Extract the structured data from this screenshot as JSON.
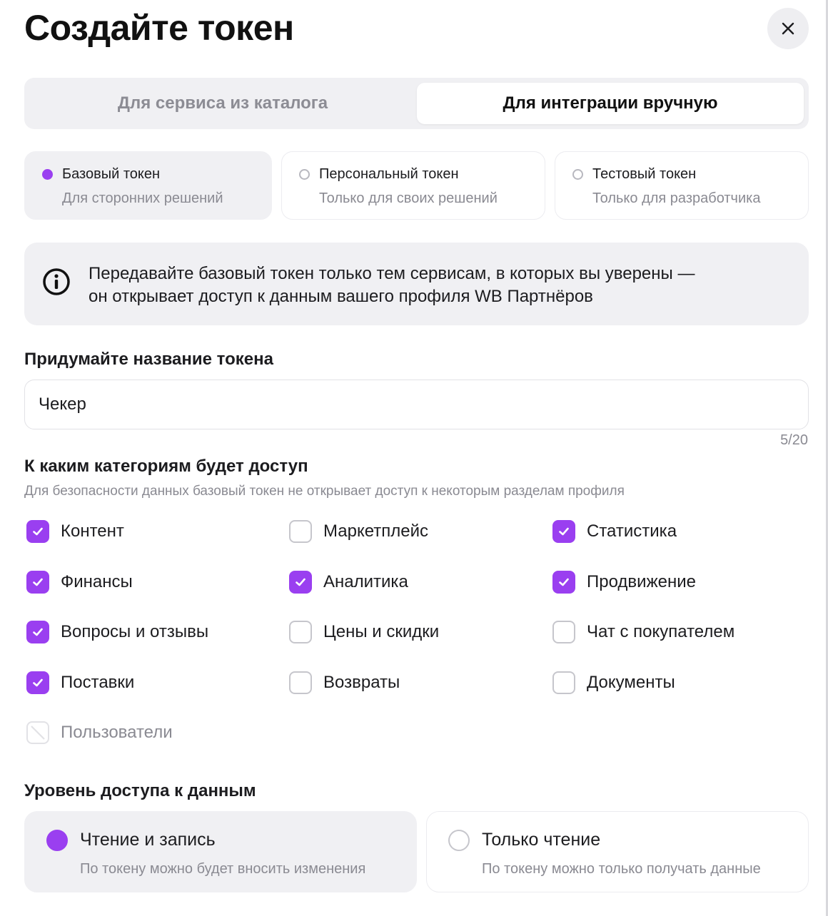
{
  "dialog": {
    "title": "Создайте токен",
    "close_icon": "close-icon"
  },
  "tabs": [
    {
      "label": "Для сервиса из каталога",
      "active": false
    },
    {
      "label": "Для интеграции вручную",
      "active": true
    }
  ],
  "token_types": [
    {
      "title": "Базовый токен",
      "subtitle": "Для сторонних решений",
      "selected": true
    },
    {
      "title": "Персональный токен",
      "subtitle": "Только для своих решений",
      "selected": false
    },
    {
      "title": "Тестовый токен",
      "subtitle": "Только для разработчика",
      "selected": false
    }
  ],
  "notice": {
    "icon": "info-icon",
    "line1": "Передавайте базовый токен только тем сервисам, в которых вы уверены —",
    "line2": "он открывает доступ к данным вашего профиля WB Партнёров"
  },
  "name_field": {
    "label": "Придумайте название токена",
    "value": "Чекер",
    "counter": "5/20"
  },
  "categories": {
    "label": "К каким категориям будет доступ",
    "hint": "Для безопасности данных базовый токен не открывает доступ к некоторым разделам профиля",
    "items": [
      {
        "label": "Контент",
        "checked": true,
        "disabled": false
      },
      {
        "label": "Маркетплейс",
        "checked": false,
        "disabled": false
      },
      {
        "label": "Статистика",
        "checked": true,
        "disabled": false
      },
      {
        "label": "Финансы",
        "checked": true,
        "disabled": false
      },
      {
        "label": "Аналитика",
        "checked": true,
        "disabled": false
      },
      {
        "label": "Продвижение",
        "checked": true,
        "disabled": false
      },
      {
        "label": "Вопросы и отзывы",
        "checked": true,
        "disabled": false
      },
      {
        "label": "Цены и скидки",
        "checked": false,
        "disabled": false
      },
      {
        "label": "Чат с покупателем",
        "checked": false,
        "disabled": false
      },
      {
        "label": "Поставки",
        "checked": true,
        "disabled": false
      },
      {
        "label": "Возвраты",
        "checked": false,
        "disabled": false
      },
      {
        "label": "Документы",
        "checked": false,
        "disabled": false
      },
      {
        "label": "Пользователи",
        "checked": false,
        "disabled": true
      }
    ]
  },
  "access_level": {
    "label": "Уровень доступа к данным",
    "options": [
      {
        "title": "Чтение и запись",
        "subtitle": "По токену можно будет вносить изменения",
        "selected": true
      },
      {
        "title": "Только чтение",
        "subtitle": "По токену можно только получать данные",
        "selected": false
      }
    ]
  },
  "colors": {
    "accent": "#9a3ff0",
    "panel": "#f0f0f3",
    "muted_text": "#8a8a92"
  }
}
